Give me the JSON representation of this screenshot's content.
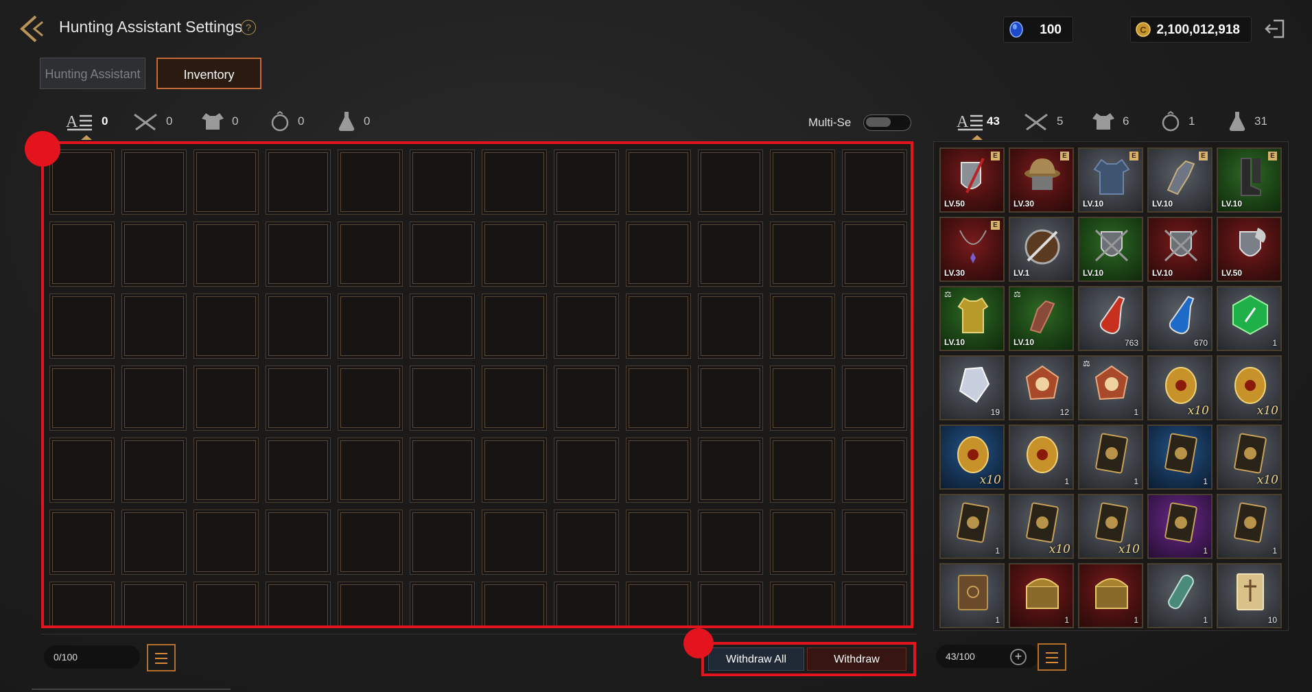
{
  "header": {
    "title": "Hunting Assistant Settings",
    "help": "?",
    "gems": "100",
    "gold": "2,100,012,918"
  },
  "tabs": [
    "Hunting Assistant",
    "Inventory"
  ],
  "storage": {
    "categories": [
      {
        "icon": "all-items-icon",
        "count": "0"
      },
      {
        "icon": "crossed-swords-icon",
        "count": "0"
      },
      {
        "icon": "armor-icon",
        "count": "0"
      },
      {
        "icon": "ring-icon",
        "count": "0"
      },
      {
        "icon": "potion-flask-icon",
        "count": "0"
      }
    ],
    "multi_select_label": "Multi-Se",
    "capacity": "0/100",
    "withdraw_all": "Withdraw All",
    "withdraw": "Withdraw"
  },
  "inventory": {
    "categories": [
      {
        "icon": "all-items-icon",
        "count": "43"
      },
      {
        "icon": "crossed-swords-icon",
        "count": "5"
      },
      {
        "icon": "armor-icon",
        "count": "6"
      },
      {
        "icon": "ring-icon",
        "count": "1"
      },
      {
        "icon": "potion-flask-icon",
        "count": "31"
      }
    ],
    "capacity": "43/100",
    "items": [
      {
        "name": "sword-shield",
        "bg": "red",
        "level": "LV.50",
        "badge": "E"
      },
      {
        "name": "kettle-helmet",
        "bg": "red",
        "level": "LV.30",
        "badge": "E"
      },
      {
        "name": "chest-armor",
        "bg": "gray",
        "level": "LV.10",
        "badge": "E"
      },
      {
        "name": "gauntlet",
        "bg": "gray",
        "level": "LV.10",
        "badge": "E"
      },
      {
        "name": "boots",
        "bg": "green",
        "level": "LV.10",
        "badge": "E"
      },
      {
        "name": "necklace",
        "bg": "red",
        "level": "LV.30",
        "badge": "E"
      },
      {
        "name": "round-shield-sword",
        "bg": "gray",
        "level": "LV.1"
      },
      {
        "name": "shield-swords",
        "bg": "green",
        "level": "LV.10"
      },
      {
        "name": "shield-swords",
        "bg": "red",
        "level": "LV.10"
      },
      {
        "name": "shield-axe",
        "bg": "red",
        "level": "LV.50"
      },
      {
        "name": "tunic",
        "bg": "green",
        "level": "LV.10",
        "scale": true
      },
      {
        "name": "leather-glove",
        "bg": "green",
        "level": "LV.10",
        "scale": true
      },
      {
        "name": "red-potion",
        "bg": "gray",
        "qty": "763"
      },
      {
        "name": "blue-potion",
        "bg": "gray",
        "qty": "670"
      },
      {
        "name": "green-gem",
        "bg": "gray",
        "qty": "1"
      },
      {
        "name": "crystal",
        "bg": "gray",
        "qty": "19"
      },
      {
        "name": "compass-stone",
        "bg": "gray",
        "qty": "12"
      },
      {
        "name": "compass-stone",
        "bg": "gray",
        "qty": "1",
        "scale": true
      },
      {
        "name": "golden-egg",
        "bg": "gray",
        "x10": "x10"
      },
      {
        "name": "golden-egg",
        "bg": "gray",
        "x10": "x10"
      },
      {
        "name": "golden-egg",
        "bg": "blue",
        "x10": "x10"
      },
      {
        "name": "golden-egg",
        "bg": "gray",
        "qty": "1"
      },
      {
        "name": "card",
        "bg": "gray",
        "qty": "1"
      },
      {
        "name": "card",
        "bg": "blue",
        "qty": "1"
      },
      {
        "name": "card",
        "bg": "gray",
        "x10": "x10"
      },
      {
        "name": "card",
        "bg": "gray",
        "qty": "1"
      },
      {
        "name": "card",
        "bg": "gray",
        "x10": "x10"
      },
      {
        "name": "card",
        "bg": "gray",
        "x10": "x10"
      },
      {
        "name": "card",
        "bg": "purple",
        "qty": "1"
      },
      {
        "name": "card",
        "bg": "gray",
        "qty": "1"
      },
      {
        "name": "book",
        "bg": "gray",
        "qty": "1"
      },
      {
        "name": "treasure-chest",
        "bg": "red",
        "qty": "1"
      },
      {
        "name": "treasure-chest",
        "bg": "red",
        "qty": "1"
      },
      {
        "name": "scroll-roll",
        "bg": "gray",
        "qty": "1"
      },
      {
        "name": "parchment",
        "bg": "gray",
        "qty": "10"
      }
    ]
  },
  "colors": {
    "highlight": "#e3141e",
    "accent": "#c46a3b"
  }
}
